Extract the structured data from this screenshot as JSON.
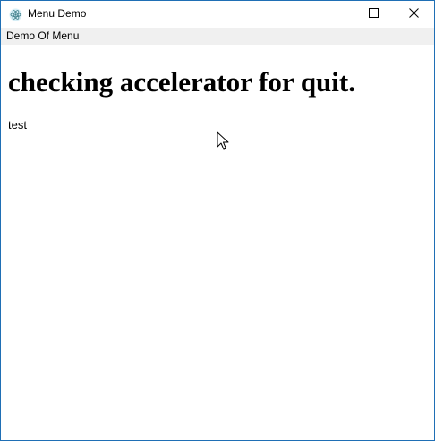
{
  "window": {
    "title": "Menu Demo",
    "app_icon": "electron-atom-icon",
    "controls": {
      "minimize_icon": "minimize-icon",
      "maximize_icon": "maximize-icon",
      "close_icon": "close-icon"
    },
    "border_color": "#1f6fb5"
  },
  "menubar": {
    "items": [
      {
        "label": "Demo Of Menu"
      }
    ]
  },
  "content": {
    "heading": "checking accelerator for quit.",
    "paragraph": "test"
  },
  "cursor": {
    "icon": "mouse-pointer-icon"
  }
}
